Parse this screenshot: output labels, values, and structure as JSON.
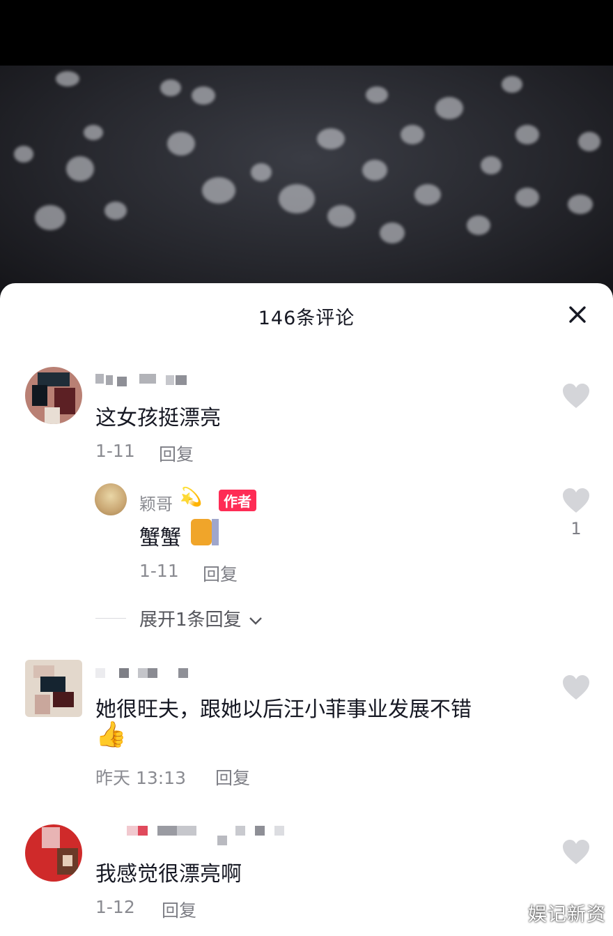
{
  "sheet": {
    "title": "146条评论"
  },
  "comments": [
    {
      "text": "这女孩挺漂亮",
      "date": "1-11",
      "reply_label": "回复",
      "replies": [
        {
          "username": "颖哥",
          "badge": "作者",
          "text": "蟹蟹",
          "date": "1-11",
          "reply_label": "回复",
          "likes": "1"
        }
      ],
      "expand_label": "展开1条回复"
    },
    {
      "text": "她很旺夫，跟她以后汪小菲事业发展不错",
      "date": "昨天 13:13",
      "reply_label": "回复"
    },
    {
      "text": "我感觉很漂亮啊",
      "date": "1-12",
      "reply_label": "回复"
    }
  ],
  "watermark": "娱记新资",
  "colors": {
    "author_badge": "#fe2c55",
    "heart": "#d4d5d9",
    "text": "#161823",
    "muted": "#8a8b91"
  },
  "icons": [
    "close-icon",
    "heart-icon",
    "chevron-down-icon",
    "thumbs-up-emoji",
    "cat-emoji",
    "sparkle-emoji"
  ]
}
